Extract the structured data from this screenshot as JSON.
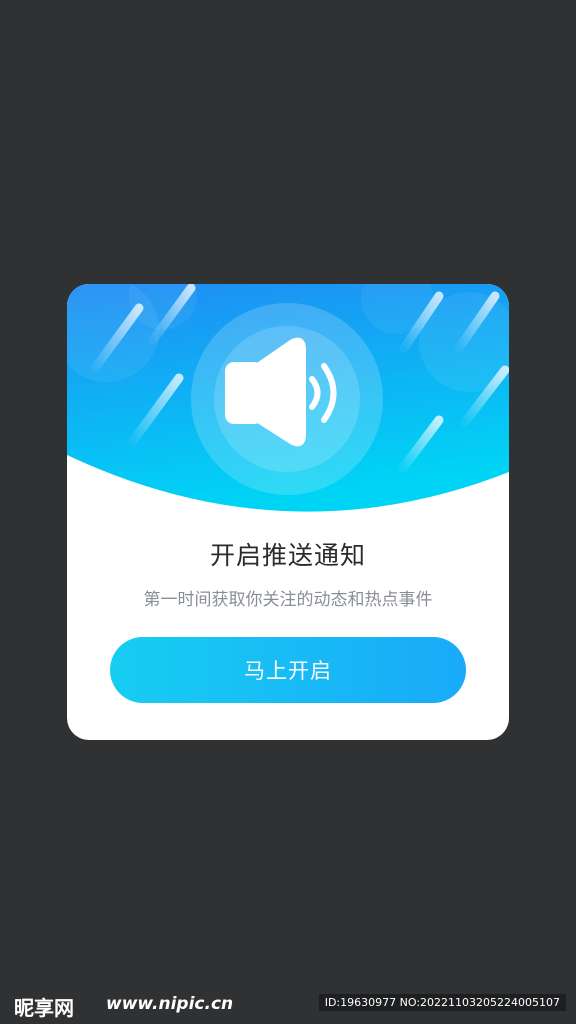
{
  "dialog": {
    "title": "开启推送通知",
    "subtitle": "第一时间获取你关注的动态和热点事件",
    "button_label": "马上开启",
    "icon": "speaker-icon"
  },
  "colors": {
    "page_background": "#2f3133",
    "card_background": "#ffffff",
    "header_gradient_start": "#1f8cf4",
    "header_gradient_end": "#00d4f5",
    "button_gradient_start": "#17cdf2",
    "button_gradient_end": "#19aaf9",
    "title_text": "#2b2b2b",
    "subtitle_text": "#8a8f96"
  },
  "watermark": {
    "logo": "昵享网",
    "url": "www.nipic.cn",
    "id_text": "ID:19630977 NO:20221103205224005107"
  }
}
